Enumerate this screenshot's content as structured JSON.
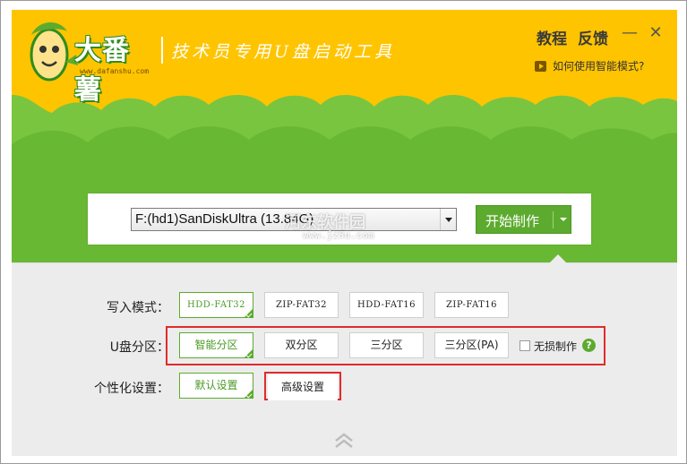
{
  "header": {
    "logo_text": "大番薯",
    "logo_url": "www.dafanshu.com",
    "slogan": "技术员专用U盘启动工具",
    "nav": {
      "tutorial": "教程",
      "feedback": "反馈"
    },
    "help_link": "如何使用智能模式?",
    "minimize_glyph": "—",
    "close_glyph": "✕"
  },
  "device": {
    "selected": "F:(hd1)SanDiskUltra (13.84G)",
    "start_label": "开始制作",
    "watermark": "河东软件园",
    "watermark_url": "www.jz5u.com"
  },
  "settings": {
    "write_mode": {
      "label": "写入模式：",
      "options": [
        "HDD-FAT32",
        "ZIP-FAT32",
        "HDD-FAT16",
        "ZIP-FAT16"
      ],
      "selected": "HDD-FAT32"
    },
    "partition": {
      "label": "U盘分区：",
      "options": [
        "智能分区",
        "双分区",
        "三分区",
        "三分区(PA)"
      ],
      "selected": "智能分区",
      "lossless_label": "无损制作",
      "lossless_checked": false,
      "help_glyph": "?"
    },
    "personalize": {
      "label": "个性化设置：",
      "options": [
        "默认设置",
        "高级设置"
      ],
      "selected": "默认设置"
    }
  },
  "colors": {
    "accent_green": "#5cab2f",
    "header_yellow": "#ffc400",
    "highlight_red": "#e02b2b"
  },
  "icons": [
    "mascot-icon",
    "play-icon",
    "dropdown-arrow-icon",
    "help-icon",
    "collapse-chevron-icon",
    "minimize-icon",
    "close-icon"
  ]
}
